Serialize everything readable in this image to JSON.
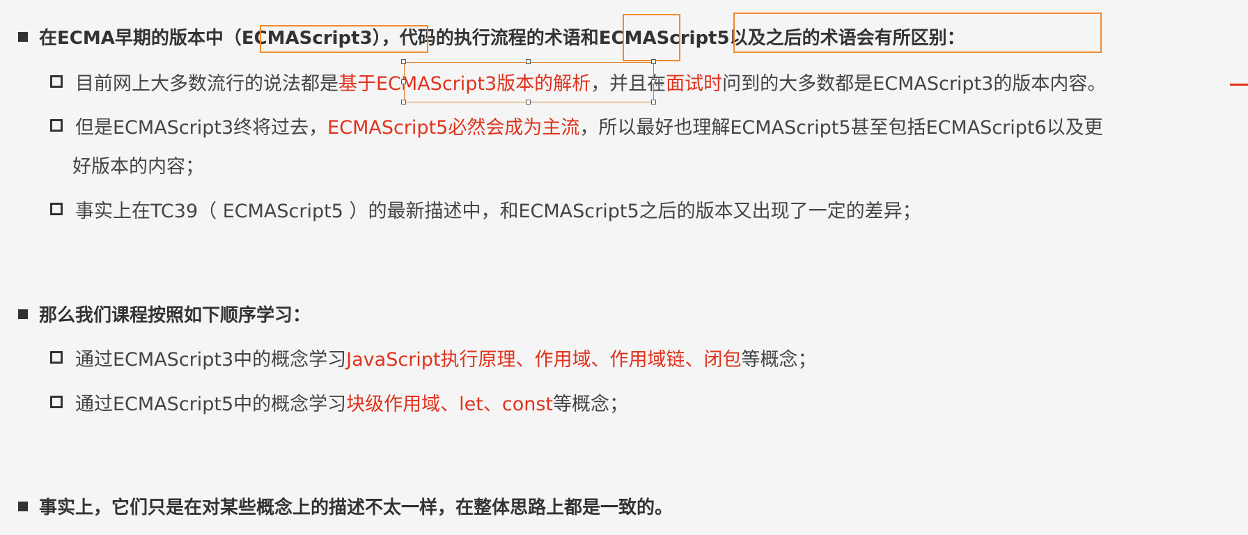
{
  "section1": {
    "heading_pre": "在ECMA早期的版本中",
    "heading_paren": "（ECMAScript3）",
    "heading_post_a": "，代码的执行流程的",
    "heading_term": "术语",
    "heading_post_b": "和",
    "heading_tail": "ECMAScript5以及之后的术语会有所区别：",
    "items": [
      {
        "pre": "目前网上大多数流行的说法都是",
        "red1": "基于ECMAScript3版本的解析",
        "mid": "，并且在",
        "red2": "面试时",
        "post": "问到的大多数都是ECMAScript3的版本内容。"
      },
      {
        "pre": "但是ECMAScript3终将过去，",
        "red1": "ECMAScript5必然会成为主流",
        "post": "，所以最好也理解ECMAScript5甚至包括ECMAScript6以及更",
        "cont": "好版本的内容；"
      },
      {
        "text": "事实上在TC39（ ECMAScript5 ）的最新描述中，和ECMAScript5之后的版本又出现了一定的差异；"
      }
    ]
  },
  "section2": {
    "heading": "那么我们课程按照如下顺序学习：",
    "items": [
      {
        "pre": "通过ECMAScript3中的概念学习",
        "red": "JavaScript执行原理、作用域、作用域链、闭包",
        "post": "等概念；"
      },
      {
        "pre": "通过ECMAScript5中的概念学习",
        "red": "块级作用域、let、const",
        "post": "等概念；"
      }
    ]
  },
  "section3": {
    "heading": "事实上，它们只是在对某些概念上的描述不太一样，在整体思路上都是一致的。"
  },
  "colors": {
    "accent_red": "#e0321c",
    "highlight_orange": "#f08a2c",
    "background": "#f5f5f5"
  }
}
